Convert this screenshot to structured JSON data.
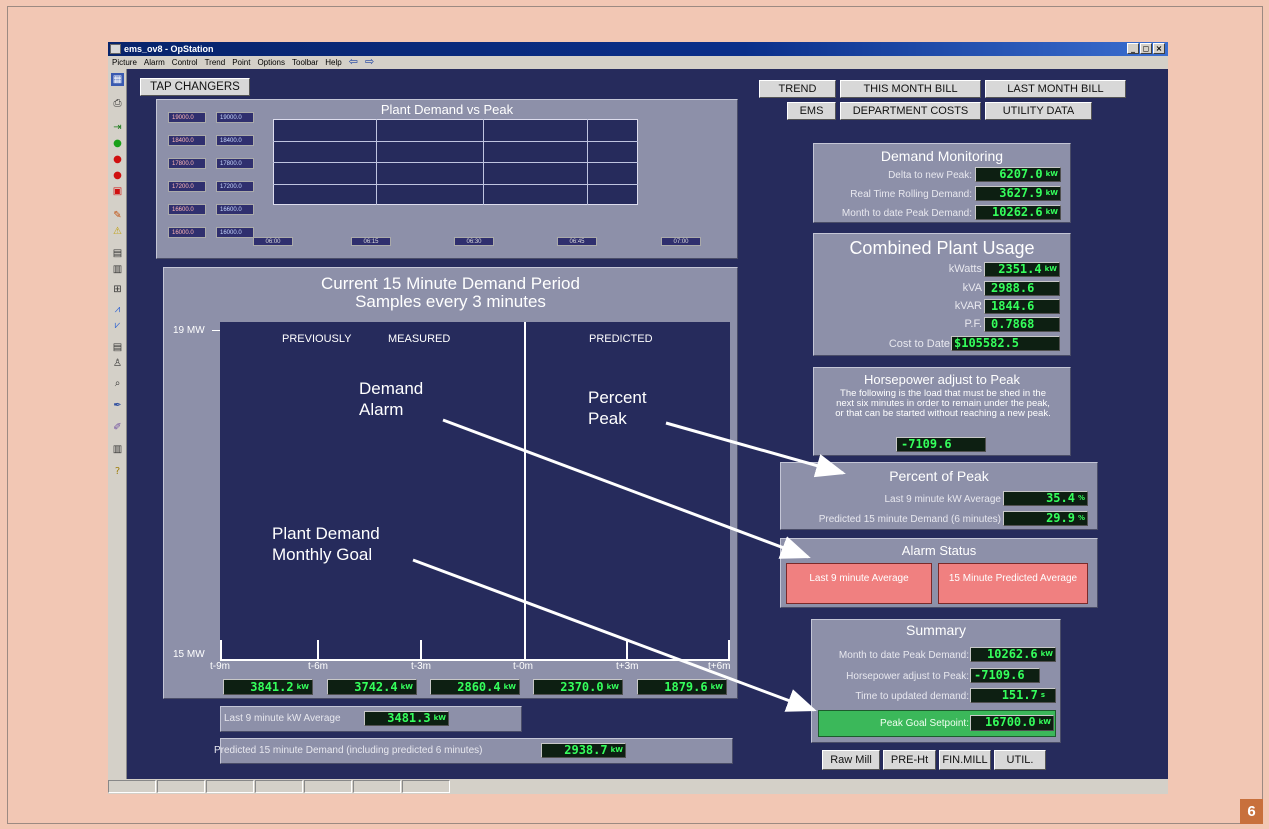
{
  "window": {
    "title": "ems_ov8 - OpStation",
    "controls": [
      "_",
      "×"
    ],
    "restore": "◻"
  },
  "menu": {
    "items": [
      "Picture",
      "Alarm",
      "Control",
      "Trend",
      "Point",
      "Options",
      "Toolbar",
      "Help"
    ],
    "back": "⇦",
    "forward": "⇨"
  },
  "nav": {
    "tap_changers": "TAP CHANGERS",
    "trend": "TREND",
    "this_month_bill": "THIS MONTH BILL",
    "last_month_bill": "LAST MONTH BILL",
    "ems": "EMS",
    "department_costs": "DEPARTMENT COSTS",
    "utility_data": "UTILITY DATA"
  },
  "trend": {
    "title": "Plant Demand vs Peak",
    "yaxis_red": [
      "19000.0",
      "18400.0",
      "17800.0",
      "17200.0",
      "16600.0",
      "16000.0"
    ],
    "yaxis_blue": [
      "19000.0",
      "18400.0",
      "17800.0",
      "17200.0",
      "16600.0",
      "16000.0"
    ],
    "xaxis": [
      "06:00",
      "06:15",
      "06:30",
      "06:45",
      "07:00"
    ]
  },
  "period": {
    "title1": "Current 15 Minute Demand Period",
    "title2": "Samples every 3 minutes",
    "ymax": "19 MW",
    "ymin": "15 MW",
    "previously": "PREVIOUSLY",
    "measured": "MEASURED",
    "predicted": "PREDICTED",
    "ticks": [
      "t-9m",
      "t-6m",
      "t-3m",
      "t-0m",
      "t+3m",
      "t+6m"
    ],
    "values": [
      "3841.2",
      "3742.4",
      "2860.4",
      "2370.0",
      "1879.6"
    ],
    "unit": "kW",
    "last9_label": "Last 9 minute kW Average",
    "last9_value": "3481.3",
    "pred_label": "Predicted 15 minute Demand (including predicted 6 minutes)",
    "pred_value": "2938.7"
  },
  "annotations": {
    "demand_alarm_1": "Demand",
    "demand_alarm_2": "Alarm",
    "percent_peak_1": "Percent",
    "percent_peak_2": "Peak",
    "monthly_goal_1": "Plant Demand",
    "monthly_goal_2": "Monthly Goal"
  },
  "demand_monitoring": {
    "title": "Demand Monitoring",
    "rows": [
      {
        "label": "Delta to new Peak:",
        "value": "6207.0",
        "unit": "kW"
      },
      {
        "label": "Real Time Rolling Demand:",
        "value": "3627.9",
        "unit": "kW"
      },
      {
        "label": "Month to date Peak Demand:",
        "value": "10262.6",
        "unit": "kW"
      }
    ]
  },
  "usage": {
    "title": "Combined Plant Usage",
    "rows": [
      {
        "label": "kWatts",
        "value": "2351.4",
        "unit": "kW"
      },
      {
        "label": "kVA",
        "value": "2988.6",
        "unit": ""
      },
      {
        "label": "kVAR",
        "value": "1844.6",
        "unit": ""
      },
      {
        "label": "P.F.",
        "value": "0.7868",
        "unit": ""
      },
      {
        "label": "Cost to Date",
        "value": "$105582.5",
        "unit": ""
      }
    ]
  },
  "hp_adjust": {
    "title": "Horsepower adjust to Peak",
    "text": "The following is the load that must be shed in the next six minutes in order to remain under the peak, or that can be started without reaching a new peak.",
    "value": "-7109.6"
  },
  "percent_peak": {
    "title": "Percent of Peak",
    "rows": [
      {
        "label": "Last 9 minute kW Average",
        "value": "35.4",
        "unit": "%"
      },
      {
        "label": "Predicted 15 minute Demand (6 minutes)",
        "value": "29.9",
        "unit": "%"
      }
    ]
  },
  "alarm_status": {
    "title": "Alarm Status",
    "box1": "Last 9 minute Average",
    "box2": "15 Minute Predicted Average"
  },
  "summary": {
    "title": "Summary",
    "rows": [
      {
        "label": "Month to date Peak Demand:",
        "value": "10262.6",
        "unit": "kW"
      },
      {
        "label": "Horsepower adjust to Peak:",
        "value": "-7109.6",
        "unit": ""
      },
      {
        "label": "Time to updated demand:",
        "value": "151.7",
        "unit": "s"
      }
    ],
    "goal_label": "Peak Goal Setpoint:",
    "goal_value": "16700.0",
    "goal_unit": "kW"
  },
  "bottom_buttons": [
    "Raw Mill",
    "PRE-Ht",
    "FIN.MILL",
    "UTIL."
  ],
  "figure_number": "6",
  "colors": {
    "screen_bg": "#262b5c",
    "panel": "#8d90a9",
    "value_green": "#35ff5c",
    "alarm_red": "#f08080",
    "page_bg": "#f2c7b4"
  }
}
